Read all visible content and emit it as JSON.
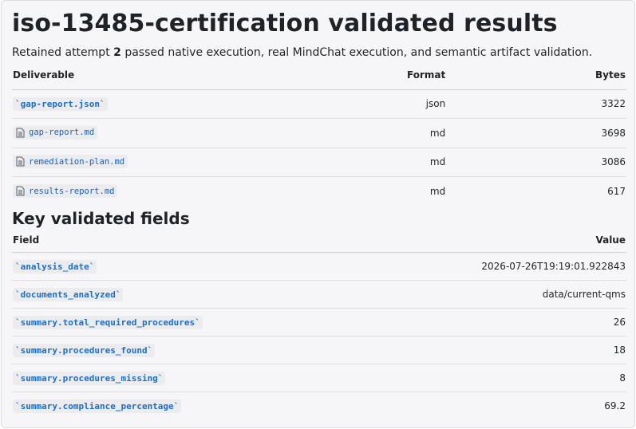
{
  "header": {
    "title": "iso-13485-certification validated results",
    "lead_prefix": "Retained attempt ",
    "lead_attempt": "2",
    "lead_suffix": " passed native execution, real MindChat execution, and semantic artifact validation."
  },
  "deliverables": {
    "columns": [
      "Deliverable",
      "Format",
      "Bytes"
    ],
    "rows": [
      {
        "name": "`gap-report.json`",
        "format": "json",
        "bytes": "3322",
        "icon": null
      },
      {
        "name": "gap-report.md",
        "format": "md",
        "bytes": "3698",
        "icon": "document-icon"
      },
      {
        "name": "remediation-plan.md",
        "format": "md",
        "bytes": "3086",
        "icon": "document-icon"
      },
      {
        "name": "results-report.md",
        "format": "md",
        "bytes": "617",
        "icon": "document-icon"
      }
    ]
  },
  "fields": {
    "heading": "Key validated fields",
    "columns": [
      "Field",
      "Value"
    ],
    "rows": [
      {
        "field": "`analysis_date`",
        "value": "2026-07-26T19:19:01.922843"
      },
      {
        "field": "`documents_analyzed`",
        "value": "data/current-qms"
      },
      {
        "field": "`summary.total_required_procedures`",
        "value": "26"
      },
      {
        "field": "`summary.procedures_found`",
        "value": "18"
      },
      {
        "field": "`summary.procedures_missing`",
        "value": "8"
      },
      {
        "field": "`summary.compliance_percentage`",
        "value": "69.2"
      }
    ]
  }
}
